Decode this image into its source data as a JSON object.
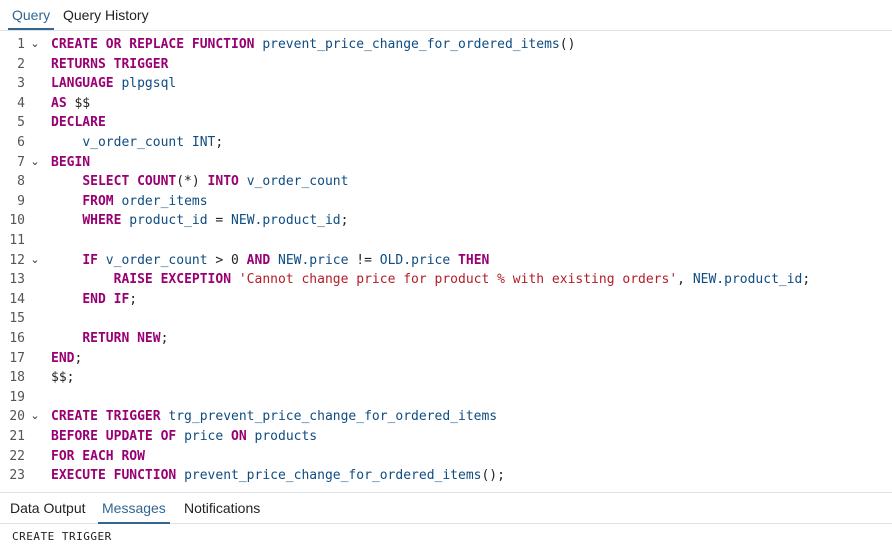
{
  "tabs": [
    "Query",
    "Query History"
  ],
  "active_tab": "Query",
  "editor": {
    "lines": [
      {
        "n": "1",
        "fold": true,
        "tokens": [
          [
            "kw",
            "CREATE OR REPLACE FUNCTION "
          ],
          [
            "id",
            "prevent_price_change_for_ordered_items"
          ],
          [
            "pn",
            "()"
          ]
        ]
      },
      {
        "n": "2",
        "fold": false,
        "tokens": [
          [
            "kw",
            "RETURNS TRIGGER"
          ]
        ]
      },
      {
        "n": "3",
        "fold": false,
        "tokens": [
          [
            "kw",
            "LANGUAGE "
          ],
          [
            "id",
            "plpgsql"
          ]
        ]
      },
      {
        "n": "4",
        "fold": false,
        "tokens": [
          [
            "kw",
            "AS "
          ],
          [
            "pn",
            "$$"
          ]
        ]
      },
      {
        "n": "5",
        "fold": false,
        "tokens": [
          [
            "kw",
            "DECLARE"
          ]
        ]
      },
      {
        "n": "6",
        "fold": false,
        "tokens": [
          [
            "pn",
            "    "
          ],
          [
            "id",
            "v_order_count INT"
          ],
          [
            "pn",
            ";"
          ]
        ]
      },
      {
        "n": "7",
        "fold": true,
        "tokens": [
          [
            "kw",
            "BEGIN"
          ]
        ]
      },
      {
        "n": "8",
        "fold": false,
        "tokens": [
          [
            "pn",
            "    "
          ],
          [
            "kw",
            "SELECT COUNT"
          ],
          [
            "pn",
            "(*) "
          ],
          [
            "kw",
            "INTO "
          ],
          [
            "id",
            "v_order_count"
          ]
        ]
      },
      {
        "n": "9",
        "fold": false,
        "tokens": [
          [
            "pn",
            "    "
          ],
          [
            "kw",
            "FROM "
          ],
          [
            "id",
            "order_items"
          ]
        ]
      },
      {
        "n": "10",
        "fold": false,
        "tokens": [
          [
            "pn",
            "    "
          ],
          [
            "kw",
            "WHERE "
          ],
          [
            "id",
            "product_id"
          ],
          [
            "pn",
            " = "
          ],
          [
            "id",
            "NEW.product_id"
          ],
          [
            "pn",
            ";"
          ]
        ]
      },
      {
        "n": "11",
        "fold": false,
        "tokens": []
      },
      {
        "n": "12",
        "fold": true,
        "tokens": [
          [
            "pn",
            "    "
          ],
          [
            "kw",
            "IF "
          ],
          [
            "id",
            "v_order_count"
          ],
          [
            "pn",
            " > "
          ],
          [
            "num",
            "0"
          ],
          [
            "kw",
            " AND "
          ],
          [
            "id",
            "NEW.price"
          ],
          [
            "pn",
            " != "
          ],
          [
            "id",
            "OLD.price"
          ],
          [
            "kw",
            " THEN"
          ]
        ]
      },
      {
        "n": "13",
        "fold": false,
        "tokens": [
          [
            "pn",
            "        "
          ],
          [
            "kw",
            "RAISE EXCEPTION "
          ],
          [
            "str",
            "'Cannot change price for product % with existing orders'"
          ],
          [
            "pn",
            ", "
          ],
          [
            "id",
            "NEW.product_id"
          ],
          [
            "pn",
            ";"
          ]
        ]
      },
      {
        "n": "14",
        "fold": false,
        "tokens": [
          [
            "pn",
            "    "
          ],
          [
            "kw",
            "END IF"
          ],
          [
            "pn",
            ";"
          ]
        ]
      },
      {
        "n": "15",
        "fold": false,
        "tokens": []
      },
      {
        "n": "16",
        "fold": false,
        "tokens": [
          [
            "pn",
            "    "
          ],
          [
            "kw",
            "RETURN NEW"
          ],
          [
            "pn",
            ";"
          ]
        ]
      },
      {
        "n": "17",
        "fold": false,
        "tokens": [
          [
            "kw",
            "END"
          ],
          [
            "pn",
            ";"
          ]
        ]
      },
      {
        "n": "18",
        "fold": false,
        "tokens": [
          [
            "pn",
            "$$;"
          ]
        ]
      },
      {
        "n": "19",
        "fold": false,
        "tokens": []
      },
      {
        "n": "20",
        "fold": true,
        "tokens": [
          [
            "kw",
            "CREATE TRIGGER "
          ],
          [
            "id",
            "trg_prevent_price_change_for_ordered_items"
          ]
        ]
      },
      {
        "n": "21",
        "fold": false,
        "tokens": [
          [
            "kw",
            "BEFORE UPDATE OF "
          ],
          [
            "id",
            "price"
          ],
          [
            "kw",
            " ON "
          ],
          [
            "id",
            "products"
          ]
        ]
      },
      {
        "n": "22",
        "fold": false,
        "tokens": [
          [
            "kw",
            "FOR EACH ROW"
          ]
        ]
      },
      {
        "n": "23",
        "fold": false,
        "tokens": [
          [
            "kw",
            "EXECUTE FUNCTION "
          ],
          [
            "id",
            "prevent_price_change_for_ordered_items"
          ],
          [
            "pn",
            "();"
          ]
        ]
      }
    ]
  },
  "result_tabs": [
    "Data Output",
    "Messages",
    "Notifications"
  ],
  "active_result_tab": "Messages",
  "message": "CREATE TRIGGER",
  "colors": {
    "keyword": "#990073",
    "identifier": "#0f4c81",
    "string": "#b31d28",
    "accent": "#326690"
  }
}
